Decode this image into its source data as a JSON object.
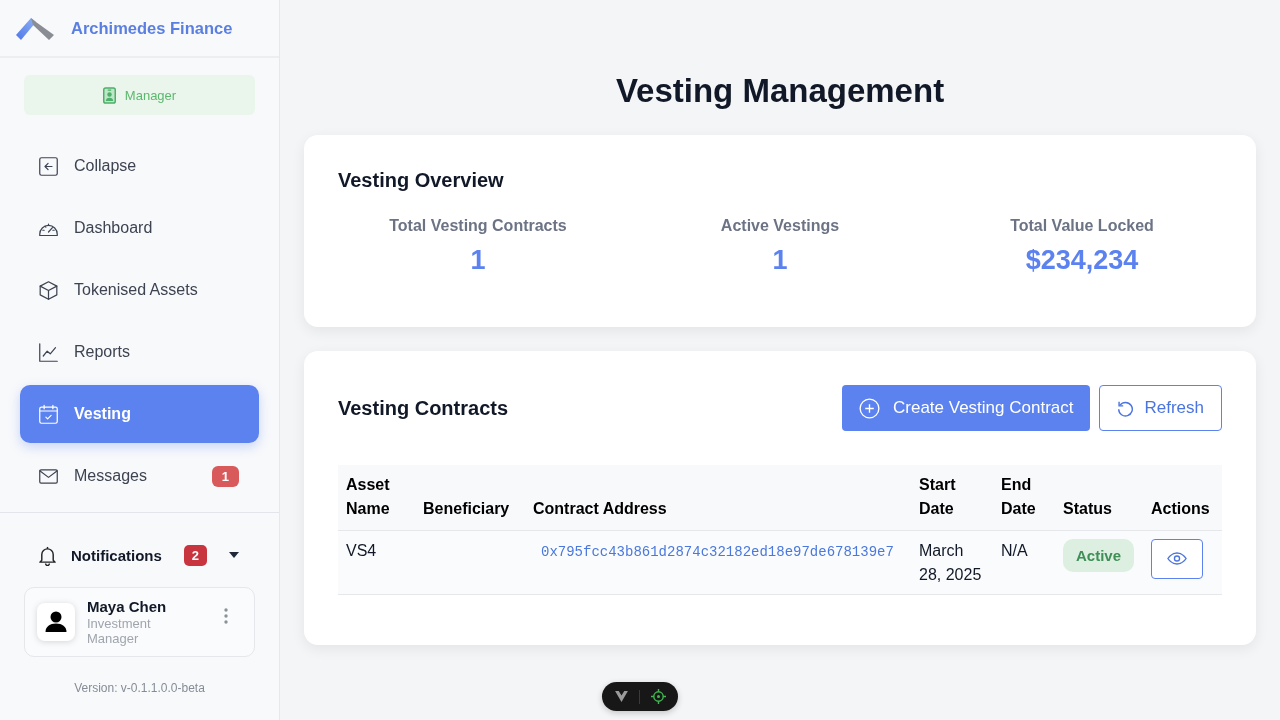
{
  "sidebar": {
    "brand": "Archimedes Finance",
    "role_badge": "Manager",
    "nav": [
      {
        "label": "Collapse",
        "selected": false
      },
      {
        "label": "Dashboard",
        "selected": false
      },
      {
        "label": "Tokenised Assets",
        "selected": false
      },
      {
        "label": "Reports",
        "selected": false
      },
      {
        "label": "Vesting",
        "selected": true
      },
      {
        "label": "Messages",
        "selected": false,
        "badge": "1"
      }
    ],
    "notifications": {
      "label": "Notifications",
      "count": "2"
    },
    "user": {
      "name": "Maya Chen",
      "role": "Investment Manager"
    },
    "version": "Version: v-0.1.1.0.0-beta"
  },
  "page_title": "Vesting Management",
  "overview": {
    "title": "Vesting Overview",
    "stats": [
      {
        "label": "Total Vesting Contracts",
        "value": "1"
      },
      {
        "label": "Active Vestings",
        "value": "1"
      },
      {
        "label": "Total Value Locked",
        "value": "$234,234"
      }
    ]
  },
  "contracts": {
    "title": "Vesting Contracts",
    "buttons": [
      {
        "label": "Create Vesting Contract",
        "kind": "primary"
      },
      {
        "label": "Refresh",
        "kind": "outline"
      }
    ],
    "table": {
      "columns": [
        "Asset Name",
        "Beneficiary",
        "Contract Address",
        "Start Date",
        "End Date",
        "Status",
        "Actions"
      ],
      "rows": [
        {
          "asset_name": "VS4",
          "contract_address": "0x795fcc43b861d2874c32182ed18e97de678139e7",
          "start_date": "March 28, 2025",
          "end_date": "N/A",
          "status": "Active"
        }
      ]
    }
  }
}
